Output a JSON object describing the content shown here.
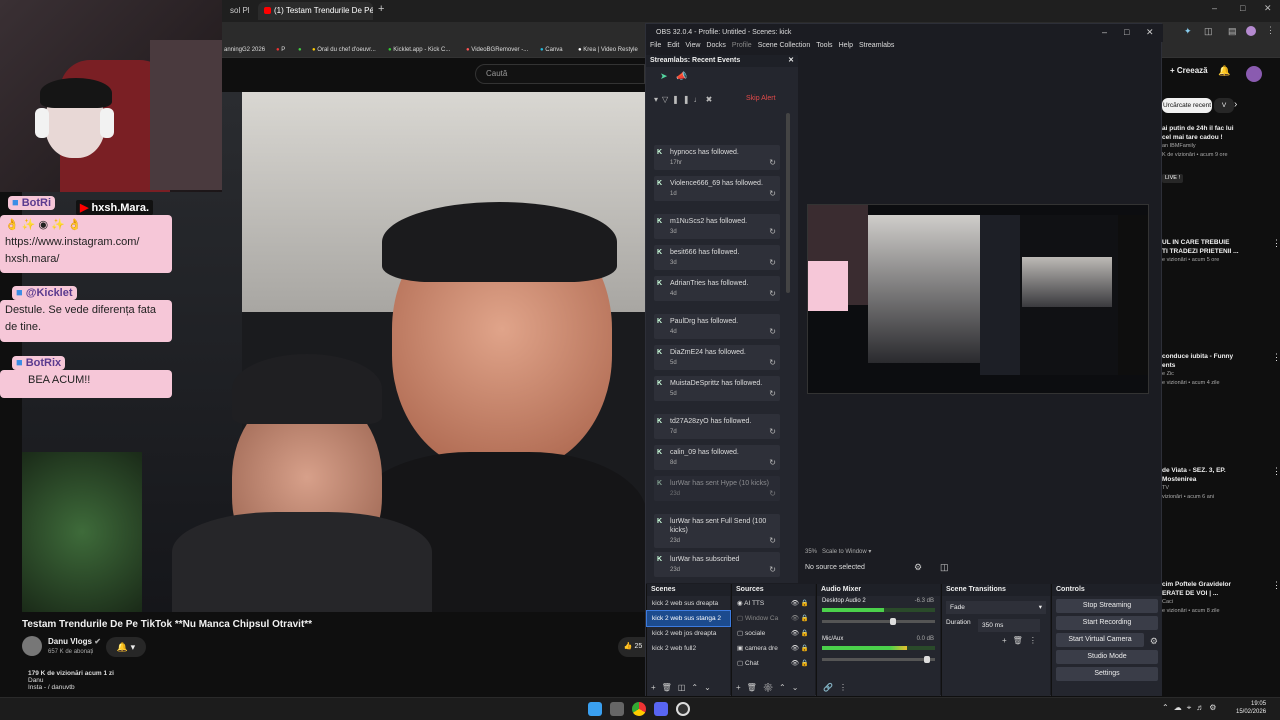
{
  "browser": {
    "tabs": [
      {
        "label": "sol Pl"
      },
      {
        "label": "(1) Testam Trendurile De Pé"
      }
    ],
    "bookmarks": [
      "anningG2 2026",
      "P",
      "Oral du chef d'oeuvr...",
      "Kicklet.app - Kick C...",
      "VideoBGRemover -...",
      "Canva",
      "Krea | Video Restyle"
    ]
  },
  "youtube": {
    "search_placeholder": "Caută",
    "create_label": "Creează",
    "video_title": "Testam Trendurile De Pe TikTok **Nu Manca Chipsul Otravit**",
    "channel_name": "Danu Vlogs",
    "subscribers": "657 K de abonați",
    "views": "179 K de vizionări  acum 1 zi",
    "desc_line1": "Danu",
    "desc_line2": "Insta -  / danuvtb",
    "like_count": "25",
    "chips": [
      "Urcărcate recent",
      "V"
    ],
    "side_videos": [
      {
        "title_1": "ai putin de 24h il fac lui",
        "title_2": "cel mai tare cadou !",
        "channel": "an IBMFamily",
        "meta": "K de vizionări • acum 9 ore",
        "live": "LIVE !"
      },
      {
        "title_1": "UL IN CARE TREBUIE",
        "title_2": "TI TRADEZI PRIETENII ...",
        "channel": "",
        "meta": "e vizionări • acum 5 ore",
        "live": ""
      },
      {
        "title_1": "conduce iubita - Funny",
        "title_2": "ents",
        "channel": "e Zic",
        "meta": "e vizionări • acum 4 zile",
        "live": ""
      },
      {
        "title_1": "de Viata - SEZ. 3, EP.",
        "title_2": "Mostenirea",
        "channel": "TV",
        "meta": "vizionări • acum 6 ani",
        "live": ""
      },
      {
        "title_1": "cim Poftele Gravidelor",
        "title_2": "ERATE DE VOI | ...",
        "channel": "Caci",
        "meta": "e vizionări • acum 8 zile",
        "live": ""
      }
    ]
  },
  "overlay": {
    "badge1": "BotRi",
    "username_tag": "hxsh.Mara.",
    "msg1": "https://www.instagram.com/ hxsh.mara/",
    "badge2": "@Kicklet",
    "msg2": "Destule. Se vede diferența fata de tine.",
    "badge3": "BotRix",
    "msg3": "BEA  ACUM!!"
  },
  "obs": {
    "title": "OBS 32.0.4 - Profile: Untitled - Scenes: kick",
    "menu": [
      "File",
      "Edit",
      "View",
      "Docks",
      "Profile",
      "Scene Collection",
      "Tools",
      "Help",
      "Streamlabs"
    ],
    "events_title": "Streamlabs: Recent Events",
    "skip_alert": "Skip Alert",
    "events": [
      {
        "text": "hypnocs has followed.",
        "time": "17hr"
      },
      {
        "text": "Violence666_69 has followed.",
        "time": "1d"
      },
      {
        "text": "m1NuScs2 has followed.",
        "time": "3d"
      },
      {
        "text": "besit666 has followed.",
        "time": "3d"
      },
      {
        "text": "AdrianTries has followed.",
        "time": "4d"
      },
      {
        "text": "PaulDrg has followed.",
        "time": "4d"
      },
      {
        "text": "DiaZmE24 has followed.",
        "time": "5d"
      },
      {
        "text": "MuistaDeSprittz has followed.",
        "time": "5d"
      },
      {
        "text": "td27A28zyO has followed.",
        "time": "7d"
      },
      {
        "text": "calin_09 has followed.",
        "time": "8d"
      },
      {
        "text": "lurWar has sent Hype (10 kicks)",
        "time": "23d"
      },
      {
        "text": "lurWar has sent Full Send (100 kicks)",
        "time": "23d"
      },
      {
        "text": "lurWar has subscribed",
        "time": "23d"
      },
      {
        "text": "lurWar has sent Hype (10 kicks)",
        "time": ""
      }
    ],
    "zoom": "35%",
    "scale_label": "Scale to Window",
    "no_source": "No source selected",
    "docks": {
      "scenes": "Scenes",
      "sources": "Sources",
      "mixer": "Audio Mixer",
      "transitions": "Scene Transitions",
      "controls": "Controls"
    },
    "scenes": [
      "kick 2 web sus dreapta",
      "kick 2 web sus stanga 2",
      "kick 2 web jos dreapta",
      "kick 2 web full2"
    ],
    "sources": [
      "AI TTS",
      "Window Ca",
      "sociale",
      "camera dre",
      "Chat"
    ],
    "mixer": [
      {
        "name": "Desktop Audio 2",
        "db": "-6.3 dB",
        "level": 0.55
      },
      {
        "name": "Mic/Aux",
        "db": "0.0 dB",
        "level": 0.75
      }
    ],
    "transition": "Fade",
    "duration_label": "Duration",
    "duration_value": "350 ms",
    "controls": [
      "Stop Streaming",
      "Start Recording",
      "Start Virtual Camera",
      "Studio Mode",
      "Settings"
    ]
  },
  "taskbar": {
    "time": "19:05",
    "date": "15/02/2026"
  }
}
